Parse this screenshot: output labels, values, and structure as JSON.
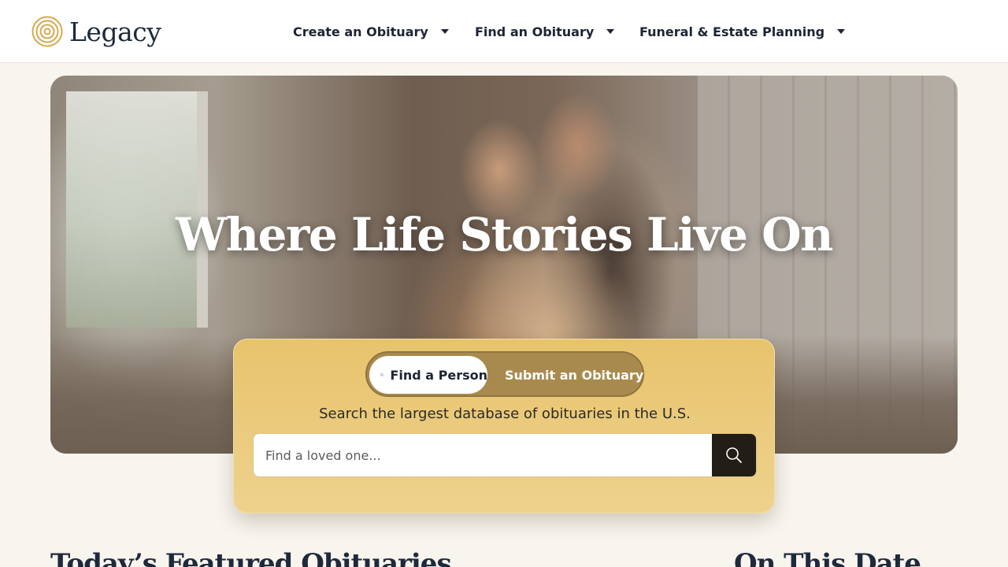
{
  "brand": {
    "name": "Legacy",
    "accent": "#d6a84f"
  },
  "nav": {
    "items": [
      {
        "label": "Create an Obituary",
        "icon": "caret-down-icon"
      },
      {
        "label": "Find an Obituary",
        "icon": "caret-down-icon"
      },
      {
        "label": "Funeral & Estate Planning",
        "icon": "caret-down-icon"
      }
    ]
  },
  "hero": {
    "title": "Where Life Stories Live On"
  },
  "search": {
    "tabs": [
      {
        "label": "Find a Person",
        "icon": "search-icon",
        "active": true
      },
      {
        "label": "Submit an Obituary",
        "icon": "pen-icon",
        "active": false
      }
    ],
    "tagline": "Search the largest database of obituaries in the U.S.",
    "placeholder": "Find a loved one...",
    "value": "",
    "button_icon": "search-icon"
  },
  "sections": {
    "featured_title": "Today’s Featured Obituaries",
    "on_this_date_title": "On This Date"
  }
}
